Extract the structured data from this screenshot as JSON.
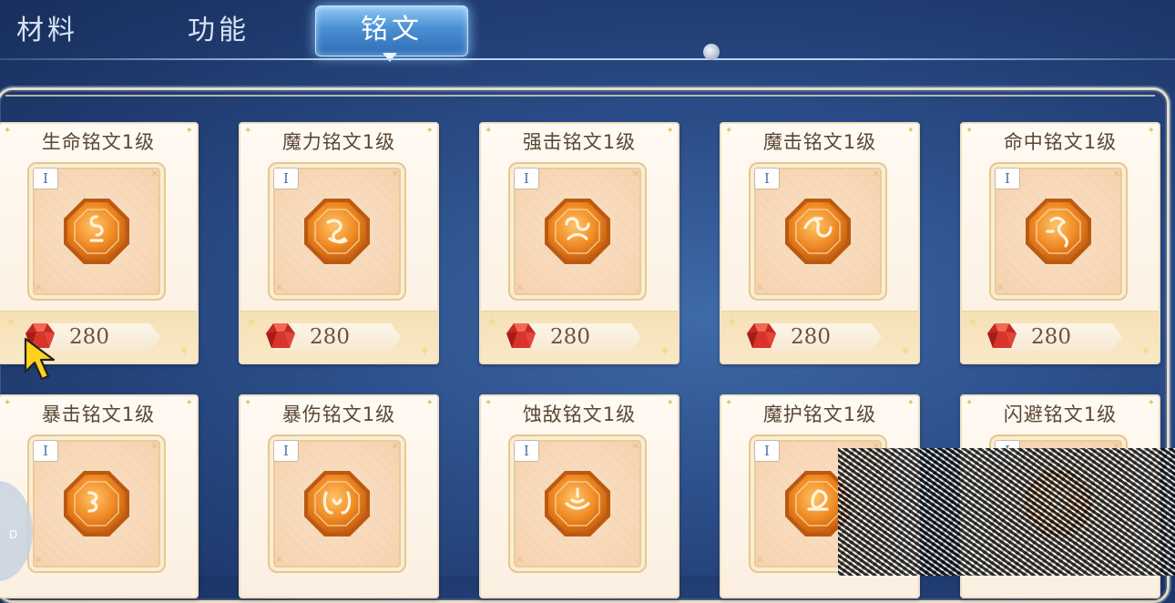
{
  "tabs": [
    {
      "label": "材料",
      "active": false
    },
    {
      "label": "功能",
      "active": false
    },
    {
      "label": "铭文",
      "active": true
    }
  ],
  "colors": {
    "active_tab": "#4a8fd3",
    "card_bg": "#fbefe0",
    "gem_orange": "#f08a24",
    "ruby_red": "#d8342a"
  },
  "items": [
    {
      "name": "生命铭文1级",
      "level": "I",
      "price": "280",
      "icon": "life-rune-icon"
    },
    {
      "name": "魔力铭文1级",
      "level": "I",
      "price": "280",
      "icon": "mana-rune-icon"
    },
    {
      "name": "强击铭文1级",
      "level": "I",
      "price": "280",
      "icon": "strike-rune-icon"
    },
    {
      "name": "魔击铭文1级",
      "level": "I",
      "price": "280",
      "icon": "magic-strike-rune-icon"
    },
    {
      "name": "命中铭文1级",
      "level": "I",
      "price": "280",
      "icon": "accuracy-rune-icon"
    },
    {
      "name": "暴击铭文1级",
      "level": "I",
      "price": "",
      "icon": "crit-rune-icon"
    },
    {
      "name": "暴伤铭文1级",
      "level": "I",
      "price": "",
      "icon": "crit-damage-rune-icon"
    },
    {
      "name": "蚀敌铭文1级",
      "level": "I",
      "price": "",
      "icon": "erode-rune-icon"
    },
    {
      "name": "魔护铭文1级",
      "level": "I",
      "price": "",
      "icon": "magic-guard-rune-icon"
    },
    {
      "name": "闪避铭文1级",
      "level": "I",
      "price": "",
      "icon": "dodge-rune-icon"
    }
  ],
  "currency_icon": "ruby-icon",
  "side_button": {
    "label": "D"
  }
}
